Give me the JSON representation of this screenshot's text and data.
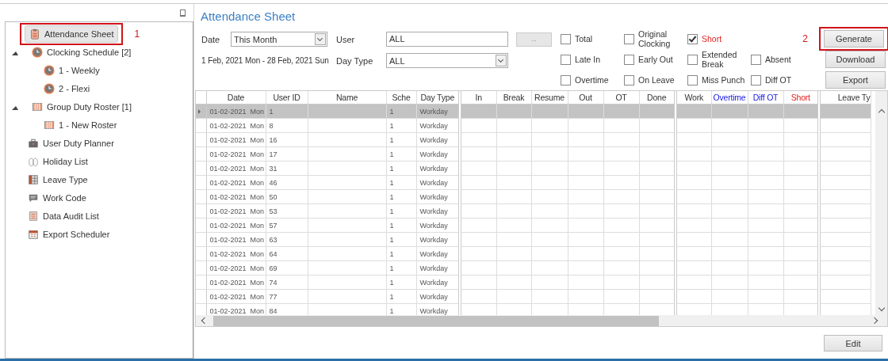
{
  "sidebar": {
    "items": [
      {
        "label": "Attendance Sheet",
        "kind": "sheet",
        "selected": true,
        "annotation": "1"
      },
      {
        "label": "Clocking Schedule [2]",
        "kind": "clock",
        "expanded": true,
        "selected": false,
        "children": [
          {
            "label": "1 - Weekly",
            "kind": "clock",
            "selected": false
          },
          {
            "label": "2 - Flexi",
            "kind": "clock",
            "selected": false
          }
        ]
      },
      {
        "label": "Group Duty Roster [1]",
        "kind": "roster",
        "expanded": true,
        "selected": false,
        "children": [
          {
            "label": "1 - New Roster",
            "kind": "roster",
            "selected": false
          }
        ]
      },
      {
        "label": "User Duty Planner",
        "kind": "briefcase",
        "selected": false
      },
      {
        "label": "Holiday List",
        "kind": "sandals",
        "selected": false
      },
      {
        "label": "Leave Type",
        "kind": "table",
        "selected": false
      },
      {
        "label": "Work Code",
        "kind": "chat",
        "selected": false
      },
      {
        "label": "Data Audit List",
        "kind": "list",
        "selected": false
      },
      {
        "label": "Export Scheduler",
        "kind": "calendar",
        "selected": false
      }
    ]
  },
  "page_title": "Attendance Sheet",
  "form": {
    "date_label": "Date",
    "date_value": "This Month",
    "user_label": "User",
    "user_value": "ALL",
    "browse_button": "...",
    "date_range": "1 Feb, 2021 Mon - 28 Feb, 2021 Sun",
    "day_type_label": "Day Type",
    "day_type_value": "ALL"
  },
  "filter_columns": [
    {
      "filters": [
        {
          "label": "Total",
          "checked": false
        },
        {
          "label": "Late In",
          "checked": false
        },
        {
          "label": "Overtime",
          "checked": false
        }
      ]
    },
    {
      "filters": [
        {
          "label": "Original Clocking",
          "checked": false
        },
        {
          "label": "Early Out",
          "checked": false
        },
        {
          "label": "On Leave",
          "checked": false
        }
      ]
    },
    {
      "filters": [
        {
          "label": "Short",
          "checked": true,
          "color": "#e02020"
        },
        {
          "label": "Extended Break",
          "checked": false
        },
        {
          "label": "Miss Punch",
          "checked": false
        }
      ]
    },
    {
      "filters": [
        {
          "label": "Absent",
          "checked": false
        },
        {
          "label": "Diff OT",
          "checked": false
        }
      ]
    }
  ],
  "buttons": [
    {
      "label": "Generate",
      "annotation": "2"
    },
    {
      "label": "Download"
    },
    {
      "label": "Export"
    }
  ],
  "table": {
    "columns": [
      {
        "label": "Date"
      },
      {
        "label": "User ID"
      },
      {
        "label": "Name"
      },
      {
        "label": "Sche"
      },
      {
        "label": "Day Type"
      },
      {
        "label": "In"
      },
      {
        "label": "Break"
      },
      {
        "label": "Resume"
      },
      {
        "label": "Out"
      },
      {
        "label": "OT"
      },
      {
        "label": "Done"
      },
      {
        "label": "Work"
      },
      {
        "label": "Overtime",
        "color": "#1a1ae0"
      },
      {
        "label": "Diff OT",
        "color": "#1a1ae0"
      },
      {
        "label": "Short",
        "color": "#e02020"
      },
      {
        "label": "Leave Ty"
      }
    ],
    "rows": [
      {
        "date": "01-02-2021  Mon",
        "user_id": "1",
        "schedule": "1",
        "day_type": "Workday",
        "selected": true
      },
      {
        "date": "01-02-2021  Mon",
        "user_id": "8",
        "schedule": "1",
        "day_type": "Workday",
        "selected": false
      },
      {
        "date": "01-02-2021  Mon",
        "user_id": "16",
        "schedule": "1",
        "day_type": "Workday",
        "selected": false
      },
      {
        "date": "01-02-2021  Mon",
        "user_id": "17",
        "schedule": "1",
        "day_type": "Workday",
        "selected": false
      },
      {
        "date": "01-02-2021  Mon",
        "user_id": "31",
        "schedule": "1",
        "day_type": "Workday",
        "selected": false
      },
      {
        "date": "01-02-2021  Mon",
        "user_id": "46",
        "schedule": "1",
        "day_type": "Workday",
        "selected": false
      },
      {
        "date": "01-02-2021  Mon",
        "user_id": "50",
        "schedule": "1",
        "day_type": "Workday",
        "selected": false
      },
      {
        "date": "01-02-2021  Mon",
        "user_id": "53",
        "schedule": "1",
        "day_type": "Workday",
        "selected": false
      },
      {
        "date": "01-02-2021  Mon",
        "user_id": "57",
        "schedule": "1",
        "day_type": "Workday",
        "selected": false
      },
      {
        "date": "01-02-2021  Mon",
        "user_id": "63",
        "schedule": "1",
        "day_type": "Workday",
        "selected": false
      },
      {
        "date": "01-02-2021  Mon",
        "user_id": "64",
        "schedule": "1",
        "day_type": "Workday",
        "selected": false
      },
      {
        "date": "01-02-2021  Mon",
        "user_id": "69",
        "schedule": "1",
        "day_type": "Workday",
        "selected": false
      },
      {
        "date": "01-02-2021  Mon",
        "user_id": "74",
        "schedule": "1",
        "day_type": "Workday",
        "selected": false
      },
      {
        "date": "01-02-2021  Mon",
        "user_id": "77",
        "schedule": "1",
        "day_type": "Workday",
        "selected": false
      },
      {
        "date": "01-02-2021  Mon",
        "user_id": "84",
        "schedule": "1",
        "day_type": "Workday",
        "selected": false
      }
    ]
  },
  "edit_button": "Edit"
}
